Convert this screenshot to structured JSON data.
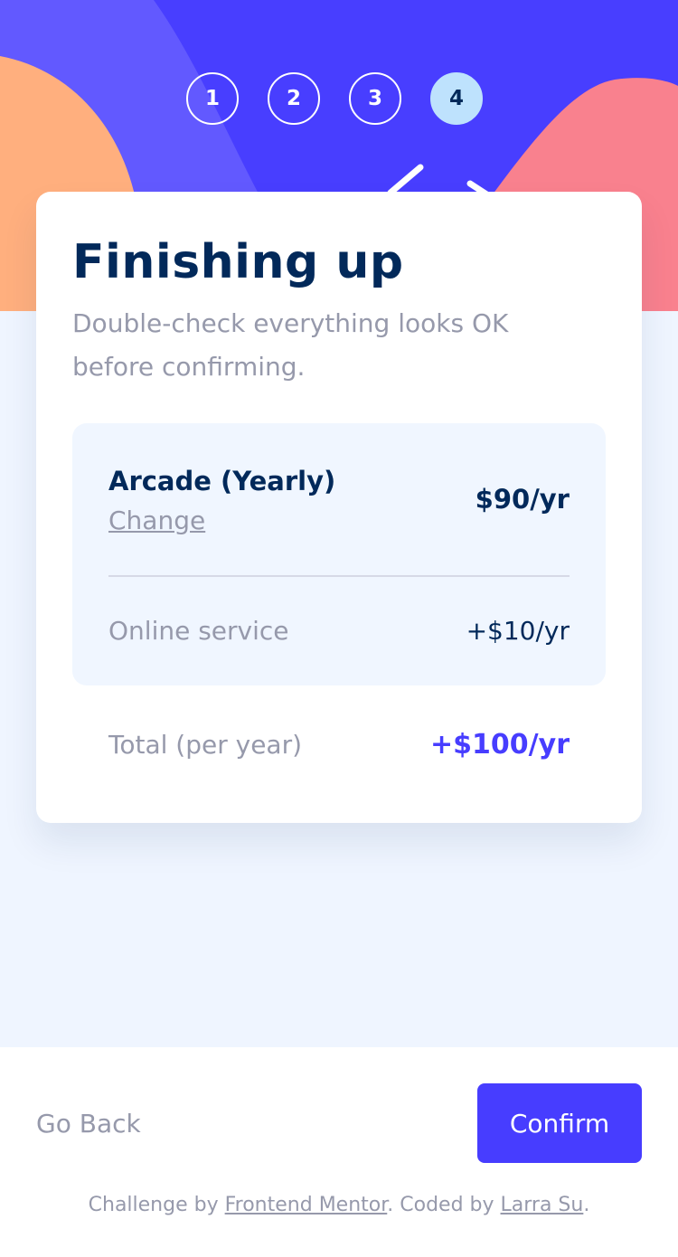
{
  "steps": [
    "1",
    "2",
    "3",
    "4"
  ],
  "active_step": "4",
  "card": {
    "title": "Finishing up",
    "subtitle": "Double-check everything looks OK before confirming."
  },
  "summary": {
    "plan_name": "Arcade (Yearly)",
    "change_label": "Change",
    "plan_price": "$90/yr",
    "addons": [
      {
        "name": "Online service",
        "price": "+$10/yr"
      }
    ],
    "total_label": "Total (per year)",
    "total_price": "+$100/yr"
  },
  "nav": {
    "back_label": "Go Back",
    "confirm_label": "Confirm"
  },
  "attribution": {
    "prefix": "Challenge by ",
    "link1": "Frontend Mentor",
    "middle": ". Coded by ",
    "link2": "Larra Su",
    "suffix": "."
  },
  "colors": {
    "marine_blue": "#02295a",
    "purplish_blue": "#473dff",
    "cool_gray": "#9699ab",
    "light_gray": "#d6d9e6",
    "magnolia": "#f0f6ff",
    "alabaster": "#eff5ff",
    "light_blue": "#bee2fd",
    "orange": "#ffaf7e",
    "pink": "#f9818e"
  }
}
